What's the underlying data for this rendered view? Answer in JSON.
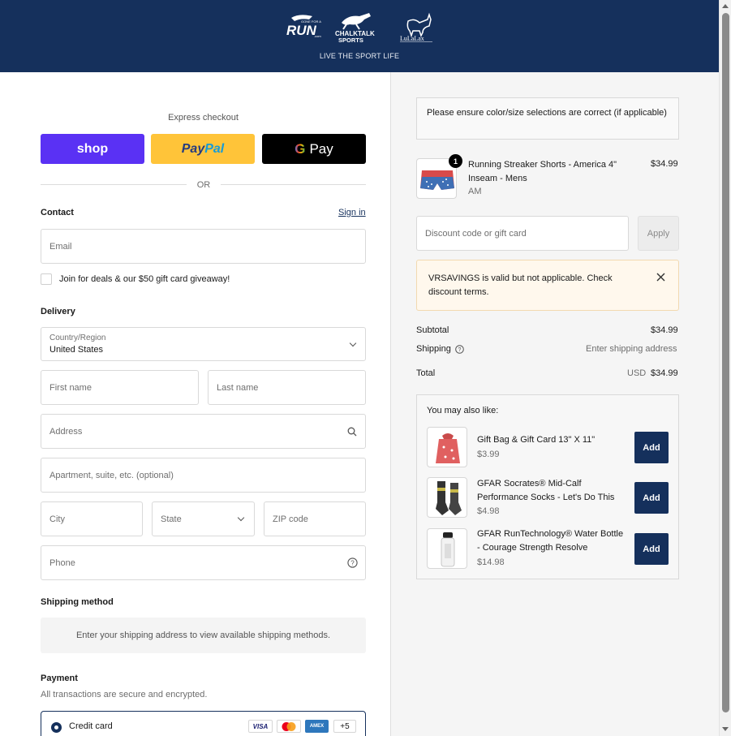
{
  "header": {
    "tagline": "LIVE THE SPORT LIFE",
    "logos": {
      "gfar_top": "GONE FOR A",
      "gfar_main": "RUN",
      "gfar_sub": ".com",
      "chalktalk_1": "CHALKTALK",
      "chalktalk_2": "SPORTS",
      "lulalax": "LuLaLax"
    },
    "bg_color": "#15305c"
  },
  "express": {
    "title": "Express checkout",
    "shop_label": "shop",
    "paypal_pay": "Pay",
    "paypal_pal": "Pal",
    "gpay_g": "G",
    "gpay_label": "Pay",
    "or": "OR"
  },
  "contact": {
    "title": "Contact",
    "sign_in": "Sign in",
    "email_placeholder": "Email",
    "newsletter_label": "Join for deals & our $50 gift card giveaway!"
  },
  "delivery": {
    "title": "Delivery",
    "country_label": "Country/Region",
    "country_value": "United States",
    "first_name": "First name",
    "last_name": "Last name",
    "address": "Address",
    "apartment": "Apartment, suite, etc. (optional)",
    "city": "City",
    "state": "State",
    "zip": "ZIP code",
    "phone": "Phone"
  },
  "shipping_method": {
    "title": "Shipping method",
    "info": "Enter your shipping address to view available shipping methods."
  },
  "payment": {
    "title": "Payment",
    "subtitle": "All transactions are secure and encrypted.",
    "method_label": "Credit card",
    "cards": [
      "VISA",
      "",
      "AMEX"
    ],
    "more": "+5"
  },
  "summary": {
    "notice": "Please ensure color/size selections are correct (if applicable)",
    "item": {
      "name": "Running Streaker Shorts - America 4\" Inseam - Mens",
      "variant": "AM",
      "price": "$34.99",
      "quantity": "1"
    },
    "discount_placeholder": "Discount code or gift card",
    "apply": "Apply",
    "alert": "VRSAVINGS is valid but not applicable. Check discount terms.",
    "subtotal_label": "Subtotal",
    "subtotal_value": "$34.99",
    "shipping_label": "Shipping",
    "shipping_value": "Enter shipping address",
    "total_label": "Total",
    "total_currency": "USD",
    "total_value": "$34.99"
  },
  "upsell": {
    "title": "You may also like:",
    "add_label": "Add",
    "items": [
      {
        "name": "Gift Bag & Gift Card 13\" X 11\"",
        "price": "$3.99"
      },
      {
        "name": "GFAR Socrates® Mid-Calf Performance Socks - Let's Do This",
        "price": "$4.98"
      },
      {
        "name": "GFAR RunTechnology® Water Bottle - Courage Strength Resolve",
        "price": "$14.98"
      }
    ]
  }
}
